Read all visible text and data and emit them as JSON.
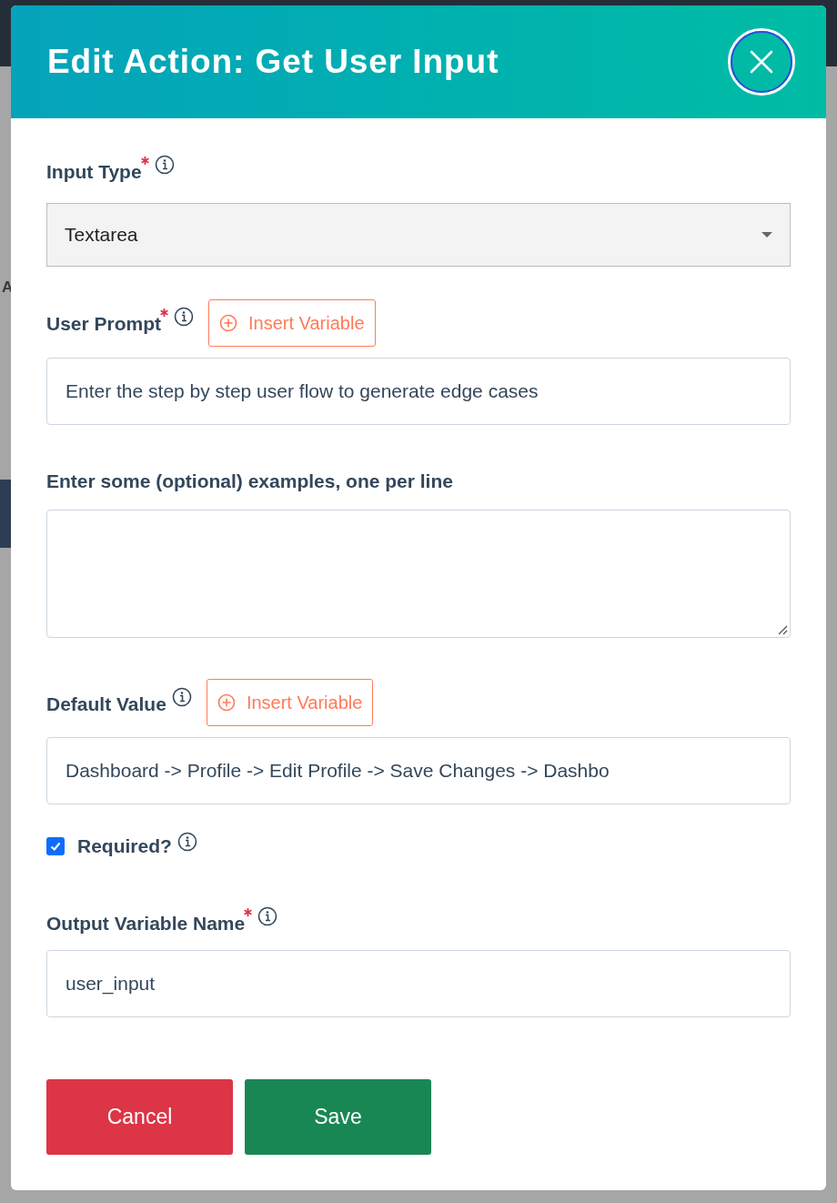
{
  "background": {
    "side_text": "A"
  },
  "dialog": {
    "title": "Edit Action: Get User Input"
  },
  "fields": [
    {
      "kind": "select",
      "label": "Input Type",
      "required": true,
      "info": true,
      "value": "Textarea"
    },
    {
      "kind": "input",
      "label": "User Prompt",
      "required": true,
      "info": true,
      "insert_button": "Insert Variable",
      "value": "Enter the step by step user flow to generate edge cases"
    },
    {
      "kind": "textarea",
      "label": "Enter some (optional) examples, one per line",
      "required": false,
      "info": false
    },
    {
      "kind": "input",
      "label": "Default Value",
      "required": false,
      "info": true,
      "insert_button": "Insert Variable",
      "value": "Dashboard -> Profile -> Edit Profile -> Save Changes -> Dashbo"
    },
    {
      "kind": "checkbox",
      "label": "Required?",
      "info": true,
      "checked": true
    },
    {
      "kind": "input",
      "label": "Output Variable Name",
      "required": true,
      "info": true,
      "value": "user_input"
    }
  ],
  "buttons": [
    {
      "label": "Cancel",
      "kind": "danger"
    },
    {
      "label": "Save",
      "kind": "primary"
    }
  ]
}
